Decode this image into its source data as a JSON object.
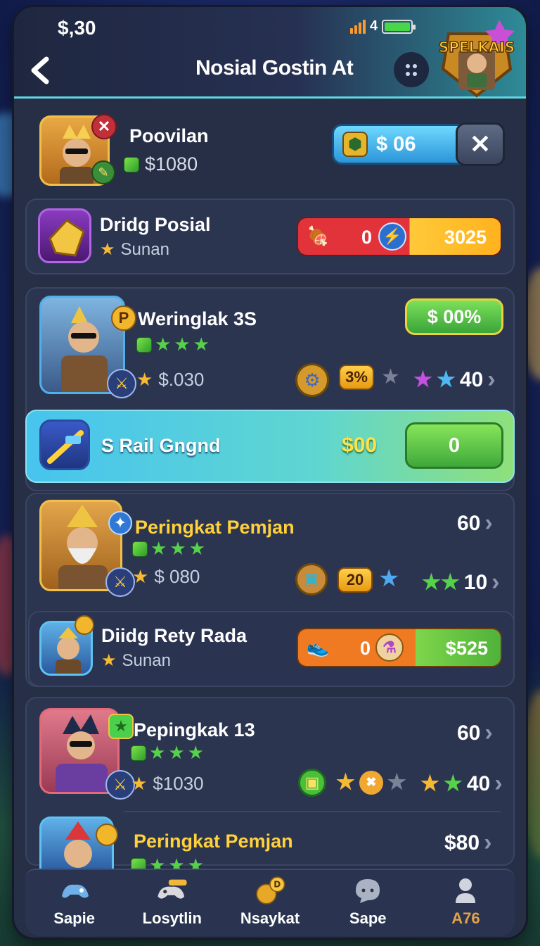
{
  "status": {
    "money": "$,30",
    "battery_label": "4"
  },
  "header": {
    "title": "Nosial Gostin At",
    "logo_text": "SPELKAIS"
  },
  "player": {
    "name": "Poovilan",
    "balance": "$1080",
    "currency_pill": "$ 06"
  },
  "rows": [
    {
      "name": "Dridg Posial",
      "sub": "Sunan",
      "left_value": "0",
      "right_value": "3025"
    },
    {
      "name": "Weringlak 3S",
      "sub": "$.030",
      "reward": "$ 00%",
      "badge": "3%",
      "count": "40"
    },
    {
      "name": "S Rail Gngnd",
      "amount": "$00",
      "button": "0"
    },
    {
      "name": "Peringkat Pemjan",
      "sub": "$ 080",
      "top_value": "60",
      "badge": "20",
      "count": "10"
    },
    {
      "name": "Diidg Rety Rada",
      "sub": "Sunan",
      "left_value": "0",
      "right_value": "$525"
    },
    {
      "name": "Pepingkak 13",
      "sub": "$1030",
      "top_value": "60",
      "count": "40"
    },
    {
      "name": "Peringkat Pemjan",
      "top_value": "$80"
    }
  ],
  "nav": [
    {
      "label": "Sapie",
      "icon": "controller-icon"
    },
    {
      "label": "Losytlin",
      "icon": "gamepad-icon"
    },
    {
      "label": "Nsaykat",
      "icon": "coin-icon"
    },
    {
      "label": "Sape",
      "icon": "chat-icon"
    },
    {
      "label": "A76",
      "icon": "profile-icon"
    }
  ]
}
